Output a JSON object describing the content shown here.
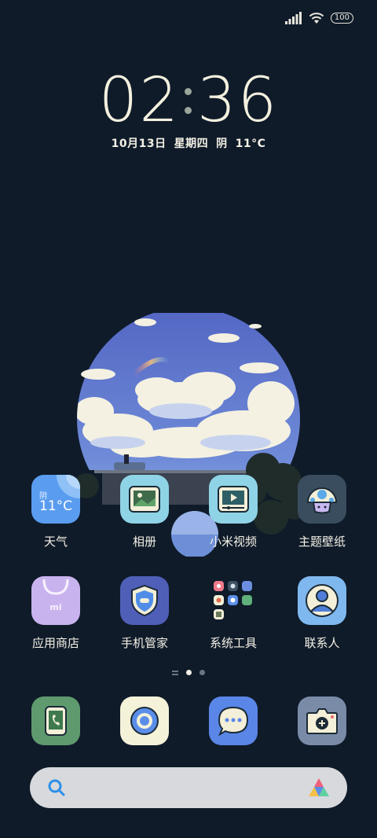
{
  "status": {
    "battery": "100"
  },
  "clock": {
    "hours": "02",
    "minutes": "36"
  },
  "date": {
    "date": "10月13日",
    "weekday": "星期四",
    "weather": "阴",
    "temp": "11°C"
  },
  "apps_row1": [
    {
      "label": "天气",
      "icon": "weather-icon",
      "widget_condition": "阴",
      "widget_temp": "11°C"
    },
    {
      "label": "相册",
      "icon": "gallery-icon"
    },
    {
      "label": "小米视频",
      "icon": "video-icon"
    },
    {
      "label": "主题壁纸",
      "icon": "themes-icon"
    }
  ],
  "apps_row2": [
    {
      "label": "应用商店",
      "icon": "app-store-icon",
      "badge": "mi"
    },
    {
      "label": "手机管家",
      "icon": "security-icon"
    },
    {
      "label": "系统工具",
      "icon": "folder-icon"
    },
    {
      "label": "联系人",
      "icon": "contacts-icon"
    }
  ],
  "dock": [
    {
      "name": "phone",
      "icon": "phone-icon"
    },
    {
      "name": "browser",
      "icon": "browser-icon"
    },
    {
      "name": "messages",
      "icon": "messages-icon"
    },
    {
      "name": "camera",
      "icon": "camera-icon"
    }
  ],
  "pages": {
    "count": 2,
    "active": 1
  },
  "search": {
    "icon": "search-icon",
    "assistant_icon": "assistant-icon"
  },
  "colors": {
    "background": "#0f1b29",
    "text": "#f4f1e6"
  }
}
